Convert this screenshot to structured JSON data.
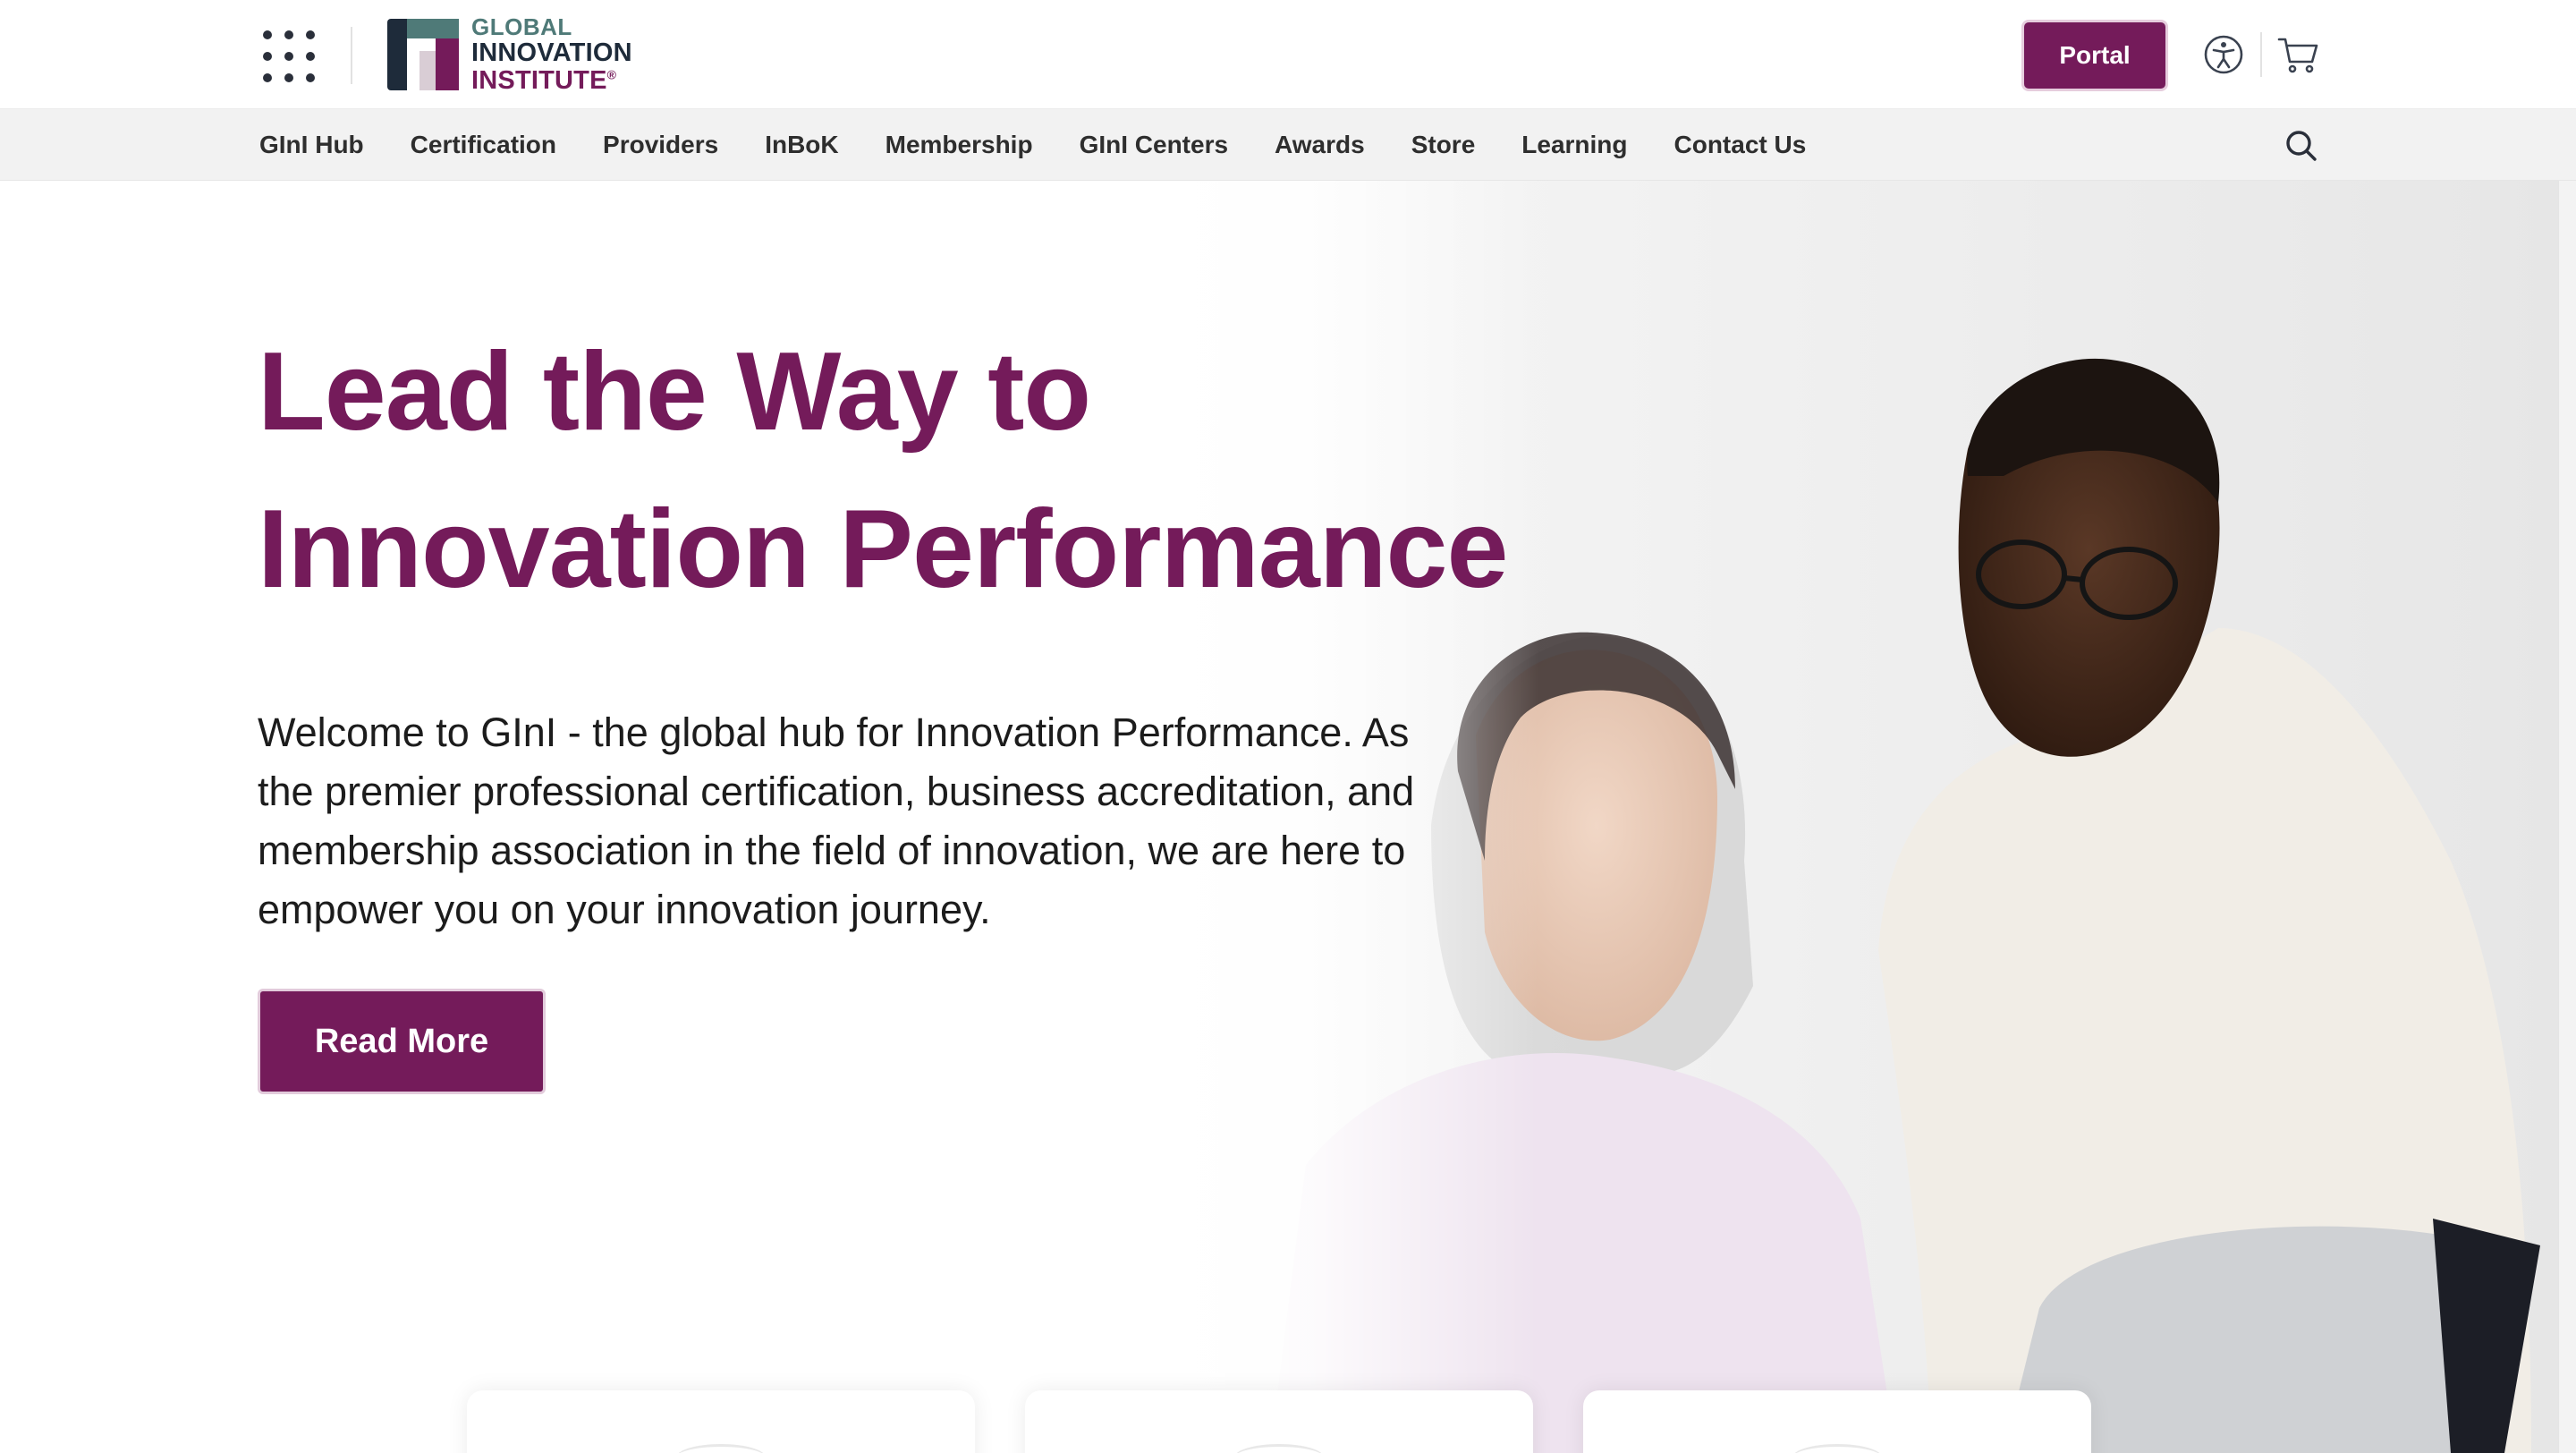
{
  "header": {
    "apps_icon": "grid-dots-icon",
    "logo": {
      "line1": "GLOBAL",
      "line2": "INNOVATION",
      "line3": "INSTITUTE",
      "reg": "®"
    },
    "portal_label": "Portal",
    "accessibility_icon": "accessibility-icon",
    "cart_icon": "shopping-cart-icon"
  },
  "nav": {
    "items": [
      {
        "label": "GInI Hub"
      },
      {
        "label": "Certification"
      },
      {
        "label": "Providers"
      },
      {
        "label": "InBoK"
      },
      {
        "label": "Membership"
      },
      {
        "label": "GInI Centers"
      },
      {
        "label": "Awards"
      },
      {
        "label": "Store"
      },
      {
        "label": "Learning"
      },
      {
        "label": "Contact Us"
      }
    ],
    "search_icon": "search-icon"
  },
  "hero": {
    "title_line1": "Lead the Way to",
    "title_line2": "Innovation Performance",
    "intro": "Welcome to GInI - the global hub for Innovation Performance. As the premier professional certification, business accreditation, and membership association in the field of innovation, we are here to empower you on your innovation journey.",
    "cta_label": "Read More"
  },
  "colors": {
    "brand_purple": "#741b5a",
    "brand_teal": "#4f7a78",
    "brand_navy": "#1e2b3a",
    "nav_bg": "#f2f2f2"
  }
}
